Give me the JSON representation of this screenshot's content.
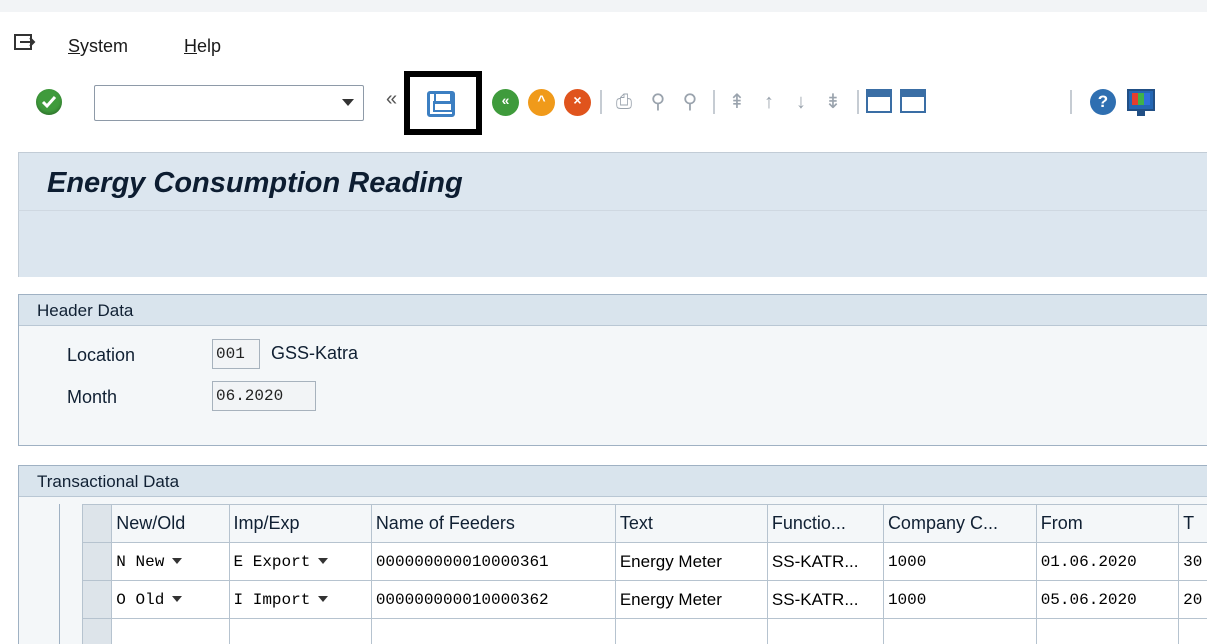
{
  "menu": {
    "items": [
      {
        "label_ul": "S",
        "label_rest": "ystem"
      },
      {
        "label_ul": "H",
        "label_rest": "elp"
      }
    ]
  },
  "toolbar": {
    "command_field_value": "",
    "collapse_glyph": "«",
    "icons": [
      "enter-icon",
      "save-icon",
      "back-icon",
      "exit-icon",
      "cancel-icon",
      "print-icon",
      "find-icon",
      "find-next-icon",
      "first-page-icon",
      "previous-page-icon",
      "next-page-icon",
      "last-page-icon",
      "create-session-icon",
      "shortcut-icon",
      "help-icon",
      "customize-layout-icon"
    ]
  },
  "screen": {
    "title": "Energy Consumption Reading"
  },
  "header_data": {
    "title": "Header Data",
    "location_label": "Location",
    "location_code": "001",
    "location_name": "GSS-Katra",
    "month_label": "Month",
    "month_value": "06.2020"
  },
  "transactional_data": {
    "title": "Transactional Data",
    "columns": [
      "New/Old",
      "Imp/Exp",
      "Name of Feeders",
      "Text",
      "Functio...",
      "Company C...",
      "From",
      "T"
    ],
    "rows": [
      {
        "new_old": "N New",
        "imp_exp": "E Export",
        "feeder": "000000000010000361",
        "text": "Energy Meter",
        "function": "SS-KATR...",
        "company": "1000",
        "from": "01.06.2020",
        "to": "30"
      },
      {
        "new_old": "O Old",
        "imp_exp": "I Import",
        "feeder": "000000000010000362",
        "text": "Energy Meter",
        "function": "SS-KATR...",
        "company": "1000",
        "from": "05.06.2020",
        "to": "20"
      }
    ]
  },
  "colors": {
    "title_band": "#dce6ef",
    "header_bar": "#d9e4ed",
    "ok_green": "#3f9b3c",
    "save_blue": "#3c7fc2"
  }
}
